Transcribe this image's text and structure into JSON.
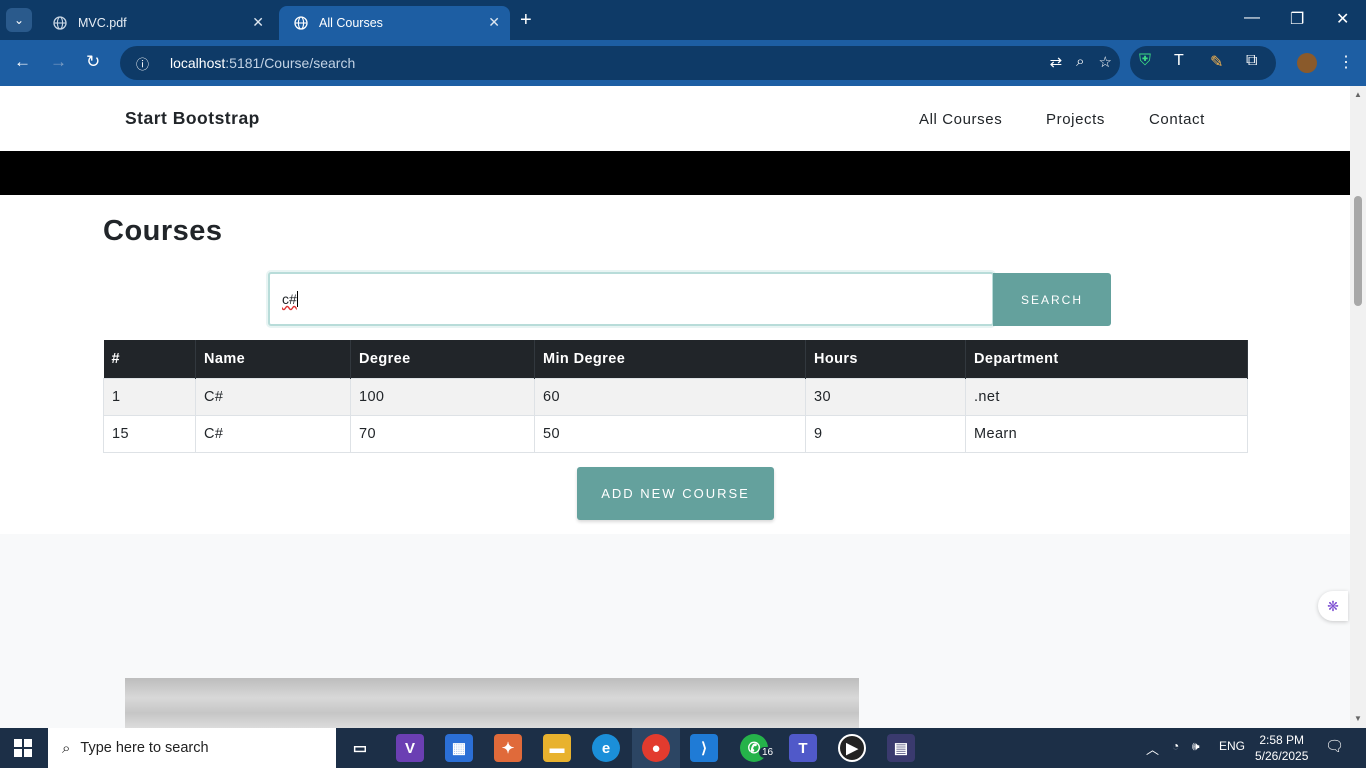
{
  "browser": {
    "tabs": [
      {
        "title": "MVC.pdf",
        "icon": "globe-icon",
        "active": false
      },
      {
        "title": "All Courses",
        "icon": "globe-icon",
        "active": true
      }
    ],
    "url_host": "localhost",
    "url_path": ":5181/Course/search"
  },
  "navbar": {
    "brand": "Start Bootstrap",
    "links": [
      "All Courses",
      "Projects",
      "Contact"
    ]
  },
  "main": {
    "title": "Courses",
    "search_value": "c#",
    "search_button": "SEARCH",
    "add_button": "ADD NEW COURSE",
    "table": {
      "headers": [
        "#",
        "Name",
        "Degree",
        "Min Degree",
        "Hours",
        "Department"
      ],
      "rows": [
        [
          "1",
          "C#",
          "100",
          "60",
          "30",
          ".net"
        ],
        [
          "15",
          "C#",
          "70",
          "50",
          "9",
          "Mearn"
        ]
      ]
    }
  },
  "taskbar": {
    "search_placeholder": "Type here to search",
    "whatsapp_badge": "16",
    "language": "ENG",
    "time": "2:58 PM",
    "date": "5/26/2025"
  },
  "colors": {
    "accent": "#64a19d",
    "table_header": "#212529",
    "chrome_frame": "#0e3a67",
    "chrome_toolbar": "#1d5ea3"
  }
}
